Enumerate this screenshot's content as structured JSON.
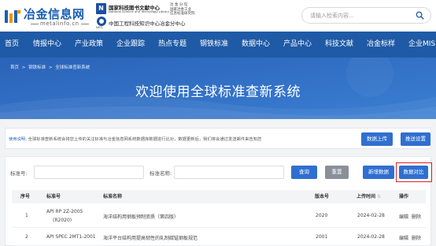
{
  "header": {
    "logo": {
      "name": "冶金信息网",
      "sub": "metalinfo.cn"
    },
    "partner": {
      "line1": "国家科技图书文献中心",
      "line1_en": "National Science and Technology Library",
      "side1": "冶 金 分 馆\n国家冶金工业\n信息标准研究院",
      "line2": "中国工程科技知识中心冶金分中心",
      "nstl": "NSTL"
    },
    "search": {
      "placeholder": "请输入检索内容..."
    }
  },
  "nav": {
    "items": [
      "首页",
      "情报中心",
      "产业政策",
      "企业跟踪",
      "热点专题",
      "钢铁标准",
      "数据中心",
      "产品中心",
      "科技文献",
      "冶金标样",
      "企业MIS"
    ]
  },
  "banner": {
    "breadcrumb": [
      "首页",
      ">",
      "钢铁标准",
      ">",
      "全球标准查新系统"
    ],
    "title": "欢迎使用全球标准查新系统"
  },
  "info": {
    "label": "使用说明:",
    "text": "全球标准查新系统会将您上传的关注标准与冶金信息网系统数据库数据进行比对，数据更新后，我们将会通过发送邮件来告知您",
    "upload_button": "数据上传",
    "notify_button": "推送设置"
  },
  "filters": {
    "std_no_label": "标准号:",
    "std_name_label": "标准名称:",
    "query_button": "查询",
    "reset_button": "重置",
    "add_button": "新增数据",
    "compare_button": "数据对比"
  },
  "table": {
    "headers": [
      "序号",
      "标准号",
      "标准名称",
      "版本号",
      "上传时间",
      "操作"
    ],
    "sort_glyph": "⇅",
    "rows": [
      {
        "index": "1",
        "std_no": [
          "API RP 2Z-2005",
          "(R2020)"
        ],
        "name": "海洋结构用钢板预制资质（第四版）",
        "version": "2020",
        "time": "2024-02-28",
        "edit": "编辑",
        "delete": "删除"
      },
      {
        "index": "2",
        "std_no": [
          "API SPEC 2MT1-2001"
        ],
        "name": "海洋平台结构用提高韧性的轧制碳锰钢板规范",
        "version": "2001",
        "time": "2024-02-28",
        "edit": "编辑",
        "delete": "删除"
      }
    ]
  },
  "colors": {
    "nav": "#1f5aa6",
    "banner": "#2b6cc0",
    "button": "#2f6fd0",
    "highlight": "#e12121"
  }
}
